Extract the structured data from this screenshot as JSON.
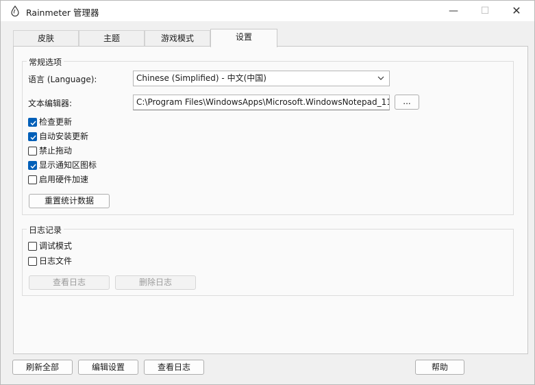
{
  "window": {
    "title": "Rainmeter 管理器",
    "minimize": "—",
    "maximize": "☐",
    "close": "✕"
  },
  "tabs": [
    {
      "label": "皮肤",
      "active": false
    },
    {
      "label": "主题",
      "active": false
    },
    {
      "label": "游戏模式",
      "active": false
    },
    {
      "label": "设置",
      "active": true
    }
  ],
  "general": {
    "group_label": "常规选项",
    "language_label": "语言 (Language):",
    "language_value": "Chinese (Simplified) - 中文(中国)",
    "editor_label": "文本编辑器:",
    "editor_value": "C:\\Program Files\\WindowsApps\\Microsoft.WindowsNotepad_11",
    "browse_label": "...",
    "checkboxes": [
      {
        "label": "检查更新",
        "checked": true
      },
      {
        "label": "自动安装更新",
        "checked": true
      },
      {
        "label": "禁止拖动",
        "checked": false
      },
      {
        "label": "显示通知区图标",
        "checked": true
      },
      {
        "label": "启用硬件加速",
        "checked": false
      }
    ],
    "reset_stats_label": "重置统计数据"
  },
  "logging": {
    "group_label": "日志记录",
    "checkboxes": [
      {
        "label": "调试模式",
        "checked": false
      },
      {
        "label": "日志文件",
        "checked": false
      }
    ],
    "view_log_label": "查看日志",
    "delete_log_label": "删除日志"
  },
  "bottom": {
    "refresh_all_label": "刷新全部",
    "edit_settings_label": "编辑设置",
    "view_log_label": "查看日志",
    "help_label": "帮助"
  },
  "colors": {
    "accent": "#005fb8",
    "window_bg": "#f0f0f0",
    "panel_bg": "#fafafa"
  }
}
